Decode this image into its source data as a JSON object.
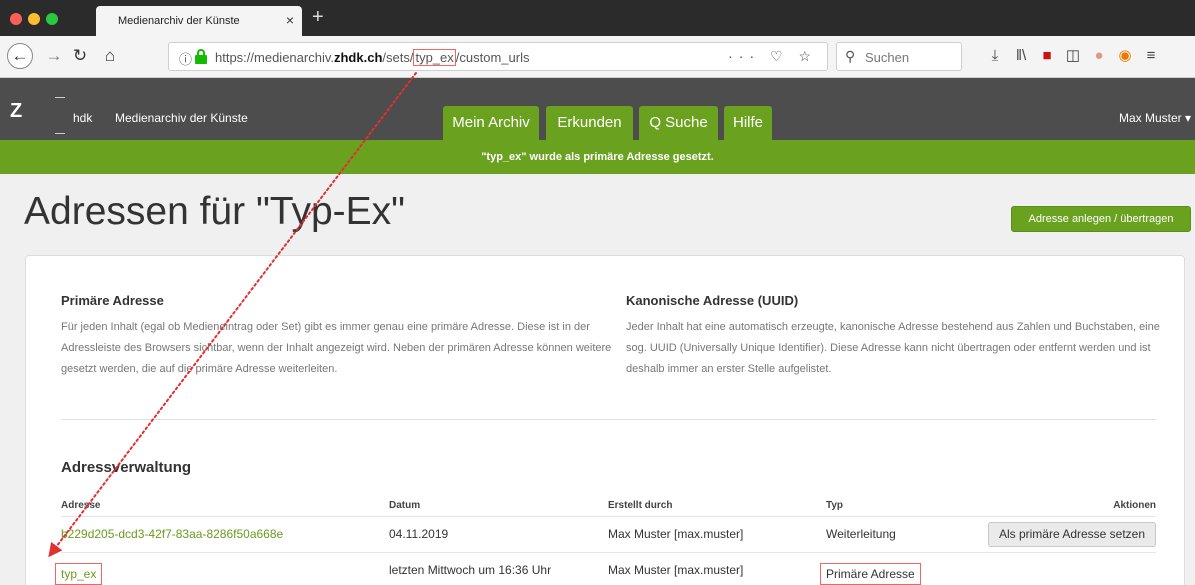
{
  "browser": {
    "tab_title": "Medienarchiv der Künste",
    "tab_close": "×",
    "new_tab": "+",
    "url_info_icon": "ⓘ",
    "url_prefix": "https://medienarchiv.",
    "url_domain": "zhdk.ch",
    "url_path_before": "/sets/",
    "url_path_highlight": "typ_ex",
    "url_path_after": "/custom_urls",
    "url_actions": "··· ♡ ☆",
    "search_placeholder": "Suchen",
    "icons": [
      "back-icon",
      "forward-icon",
      "reload-icon",
      "home-icon",
      "info-icon",
      "lock-icon",
      "page-actions-icon",
      "pocket-icon",
      "bookmark-star-icon",
      "search-icon",
      "download-icon",
      "library-icon",
      "pdf-icon",
      "sidebar-icon",
      "extension-icon",
      "chrome-extension-icon",
      "menu-icon"
    ],
    "colors": {
      "tabbar": "#2b2b2b",
      "lock": "#12bc00"
    }
  },
  "app": {
    "logo_letter": "Z",
    "logo_hdk": "hdk",
    "title": "Medienarchiv der Künste",
    "nav": [
      "Mein Archiv",
      "Erkunden",
      "Q Suche",
      "Hilfe"
    ],
    "user": "Max Muster ▾",
    "accent_color": "#6aa220",
    "header_color": "#4d4d4d"
  },
  "flash": "\"typ_ex\" wurde als primäre Adresse gesetzt.",
  "page": {
    "title": "Adressen für \"Typ-Ex\"",
    "action_button": "Adresse anlegen / übertragen"
  },
  "primary_section": {
    "title": "Primäre Adresse",
    "text": "Für jeden Inhalt (egal ob Medieneintrag oder Set) gibt es immer genau eine primäre Adresse. Diese ist in der Adressleiste des Browsers sichtbar, wenn der Inhalt angezeigt wird. Neben der primären Adresse können weitere gesetzt werden, die auf die primäre Adresse weiterleiten."
  },
  "canonical_section": {
    "title": "Kanonische Adresse (UUID)",
    "text": "Jeder Inhalt hat eine automatisch erzeugte, kanonische Adresse bestehend aus Zahlen und Buchstaben, eine sog. UUID (Universally Unique Identifier). Diese Adresse kann nicht übertragen oder entfernt werden und ist deshalb immer an erster Stelle aufgelistet."
  },
  "management": {
    "title": "Adressverwaltung",
    "columns": [
      "Adresse",
      "Datum",
      "Erstellt durch",
      "Typ",
      "Aktionen"
    ],
    "rows": [
      {
        "address": "b229d205-dcd3-42f7-83aa-8286f50a668e",
        "date": "04.11.2019",
        "created_by": "Max Muster [max.muster]",
        "type": "Weiterleitung",
        "action": "Als primäre Adresse setzen"
      },
      {
        "address": "typ_ex",
        "date": "letzten Mittwoch um 16:36 Uhr",
        "created_by": "Max Muster [max.muster]",
        "type": "Primäre Adresse",
        "action": ""
      }
    ]
  },
  "annotation_color": "#e03030"
}
